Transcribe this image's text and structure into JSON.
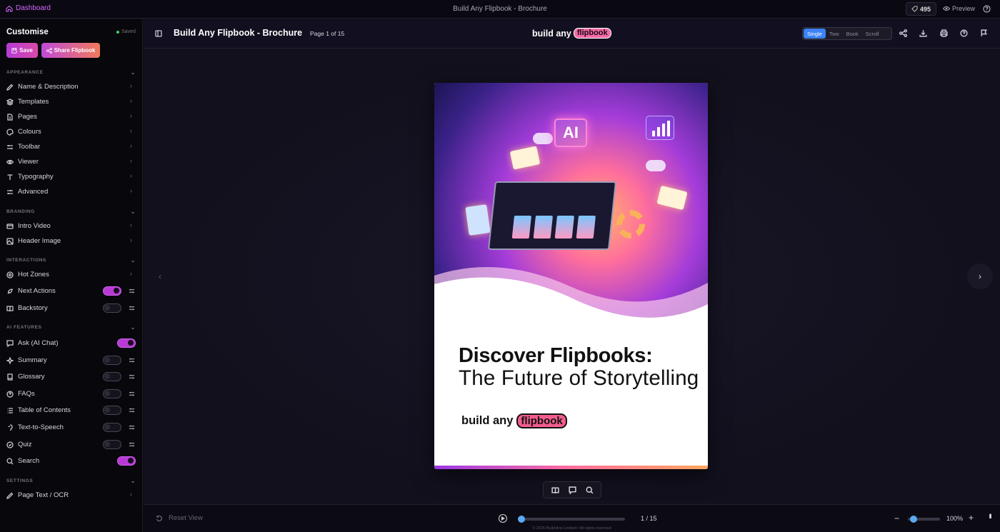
{
  "topbar": {
    "dashboard_label": "Dashboard",
    "title": "Build Any Flipbook - Brochure",
    "credits": "495",
    "preview_label": "Preview"
  },
  "sidebar": {
    "title": "Customise",
    "saved_label": "Saved",
    "save_label": "Save",
    "share_label": "Share Flipbook",
    "sections": {
      "appearance": "APPEARANCE",
      "branding": "BRANDING",
      "interactions": "INTERACTIONS",
      "ai_features": "AI FEATURES",
      "settings": "SETTINGS"
    },
    "items": {
      "name_description": "Name & Description",
      "templates": "Templates",
      "pages": "Pages",
      "colours": "Colours",
      "toolbar": "Toolbar",
      "viewer": "Viewer",
      "typography": "Typography",
      "advanced": "Advanced",
      "intro_video": "Intro Video",
      "header_image": "Header Image",
      "hot_zones": "Hot Zones",
      "next_actions": "Next Actions",
      "backstory": "Backstory",
      "ask_ai_chat": "Ask (AI Chat)",
      "summary": "Summary",
      "glossary": "Glossary",
      "faqs": "FAQs",
      "table_of_contents": "Table of Contents",
      "text_to_speech": "Text-to-Speech",
      "quiz": "Quiz",
      "search": "Search",
      "page_text_ocr": "Page Text / OCR"
    },
    "toggles": {
      "next_actions": true,
      "backstory": false,
      "ask_ai_chat": true,
      "summary": false,
      "glossary": false,
      "faqs": false,
      "table_of_contents": false,
      "text_to_speech": false,
      "quiz": false,
      "search": true
    }
  },
  "header": {
    "title": "Build Any Flipbook - Brochure",
    "page_indicator": "Page 1 of 15",
    "logo_text": "build any",
    "logo_pill": "flipbook",
    "view_modes": [
      "Single",
      "Two",
      "Book",
      "Scroll"
    ],
    "active_view_mode": "Single"
  },
  "page": {
    "headline": "Discover Flipbooks:",
    "subline": "The Future of Storytelling",
    "logo_text": "build any",
    "logo_pill": "flipbook",
    "art_label": "AI"
  },
  "footer": {
    "reset_label": "Reset View",
    "page_count": "1 / 15",
    "copyright": "© 2026 Build Any Limited • All rights reserved",
    "zoom": "100%",
    "progress": 0.0
  },
  "colors": {
    "accent": "#b83ad4",
    "active_segment": "#3b82f6",
    "slider_thumb": "#5aa9f5"
  }
}
